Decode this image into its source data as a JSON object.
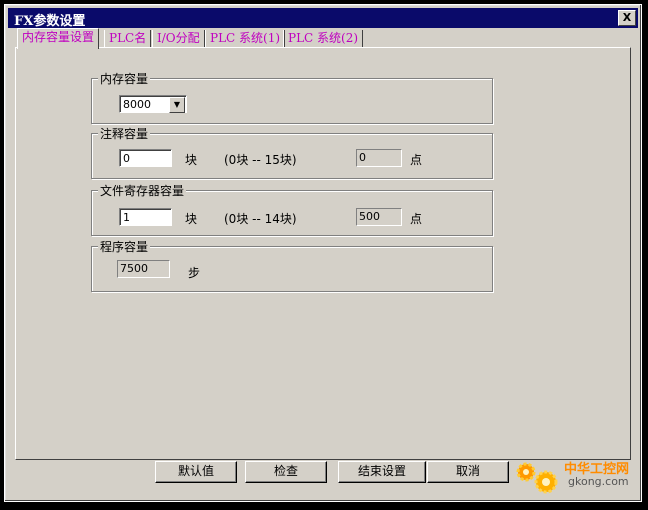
{
  "window": {
    "title": "FX参数设置",
    "close_label": "X"
  },
  "tabs": [
    "内存容量设置",
    "PLC名",
    "I/O分配",
    "PLC 系统(1)",
    "PLC 系统(2)"
  ],
  "memory": {
    "group_label": "内存容量",
    "selected": "8000"
  },
  "comment": {
    "group_label": "注释容量",
    "value": "0",
    "unit": "块",
    "range": "(0块 -- 15块)",
    "points": "0",
    "points_unit": "点"
  },
  "file_register": {
    "group_label": "文件寄存器容量",
    "value": "1",
    "unit": "块",
    "range": "(0块 -- 14块)",
    "points": "500",
    "points_unit": "点"
  },
  "program": {
    "group_label": "程序容量",
    "value": "7500",
    "unit": "步"
  },
  "buttons": {
    "default": "默认值",
    "check": "检查",
    "finish": "结束设置",
    "cancel": "取消"
  },
  "watermark": {
    "brand": "中华工控网",
    "url": "gkong.com"
  }
}
